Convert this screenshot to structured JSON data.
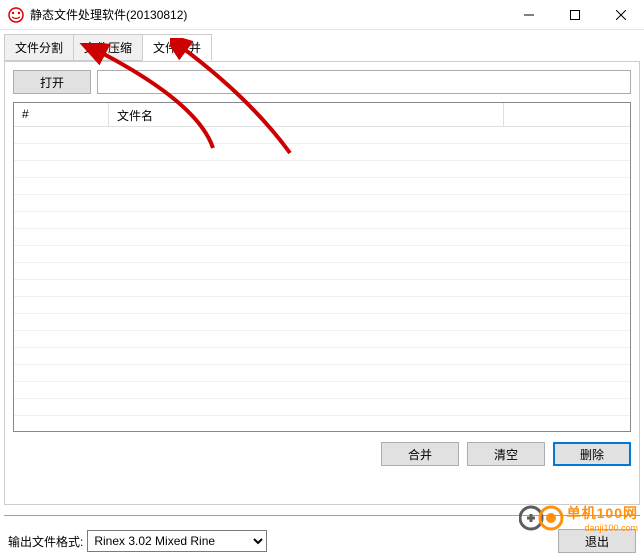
{
  "window": {
    "title": "静态文件处理软件(20130812)"
  },
  "tabs": {
    "items": [
      "文件分割",
      "文件压缩",
      "文件合并"
    ],
    "active": 2
  },
  "panel": {
    "open_label": "打开",
    "path_value": "",
    "columns": {
      "num": "#",
      "name": "文件名"
    },
    "merge_label": "合并",
    "clear_label": "清空",
    "delete_label": "删除"
  },
  "footer": {
    "format_label": "输出文件格式:",
    "format_value": "Rinex 3.02 Mixed Rine",
    "exit_label": "退出"
  },
  "watermark": {
    "cn": "单机100网",
    "url": "danji100.com"
  }
}
